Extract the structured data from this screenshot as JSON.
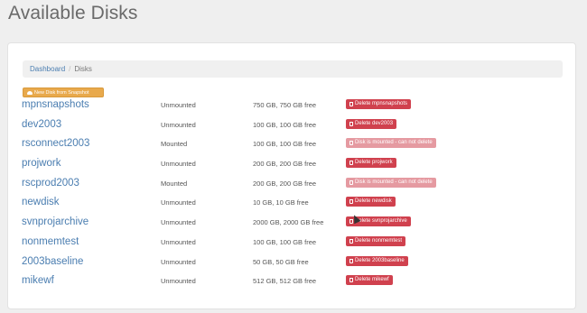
{
  "page": {
    "title": "Available Disks"
  },
  "breadcrumb": {
    "home": "Dashboard",
    "separator": "/",
    "current": "Disks"
  },
  "toolbar": {
    "new_disk_label": "New Disk from Snapshot"
  },
  "colors": {
    "accent_orange": "#e8a94c",
    "danger": "#d0414e",
    "danger_disabled": "#e59aa1",
    "link": "#4a7db0"
  },
  "disks": [
    {
      "name": "mpnsnapshots",
      "status": "Unmounted",
      "size": "750 GB, 750 GB free",
      "action": "Delete mpnsnapshots",
      "disabled": false
    },
    {
      "name": "dev2003",
      "status": "Unmounted",
      "size": "100 GB, 100 GB free",
      "action": "Delete dev2003",
      "disabled": false
    },
    {
      "name": "rsconnect2003",
      "status": "Mounted",
      "size": "100 GB, 100 GB free",
      "action": "Disk is mounted - can not delete",
      "disabled": true
    },
    {
      "name": "projwork",
      "status": "Unmounted",
      "size": "200 GB, 200 GB free",
      "action": "Delete projwork",
      "disabled": false
    },
    {
      "name": "rscprod2003",
      "status": "Mounted",
      "size": "200 GB, 200 GB free",
      "action": "Disk is mounted - can not delete",
      "disabled": true
    },
    {
      "name": "newdisk",
      "status": "Unmounted",
      "size": "10 GB, 10 GB free",
      "action": "Delete newdisk",
      "disabled": false
    },
    {
      "name": "svnprojarchive",
      "status": "Unmounted",
      "size": "2000 GB, 2000 GB free",
      "action": "Delete svnprojarchive",
      "disabled": false
    },
    {
      "name": "nonmemtest",
      "status": "Unmounted",
      "size": "100 GB, 100 GB free",
      "action": "Delete nonmemtest",
      "disabled": false
    },
    {
      "name": "2003baseline",
      "status": "Unmounted",
      "size": "50 GB, 50 GB free",
      "action": "Delete 2003baseline",
      "disabled": false
    },
    {
      "name": "mikewf",
      "status": "Unmounted",
      "size": "512 GB, 512 GB free",
      "action": "Delete mikewf",
      "disabled": false
    }
  ]
}
